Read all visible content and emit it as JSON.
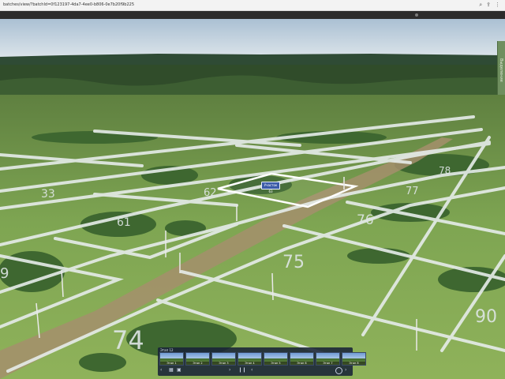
{
  "browser": {
    "url": "batches/view/?batchId=0f123197-4da7-4ee0-b806-0e7b20f9b225",
    "icons": [
      "magnifier-icon",
      "share-icon",
      "more-icon"
    ]
  },
  "side_panel": {
    "label": "Выделение"
  },
  "plots": [
    {
      "id": "plot-33",
      "label": "33"
    },
    {
      "id": "plot-61",
      "label": "61"
    },
    {
      "id": "plot-62",
      "label": "62"
    },
    {
      "id": "plot-75",
      "label": "75"
    },
    {
      "id": "plot-74",
      "label": "74"
    },
    {
      "id": "plot-76",
      "label": "76"
    },
    {
      "id": "plot-77",
      "label": "77"
    },
    {
      "id": "plot-78",
      "label": "78"
    },
    {
      "id": "plot-90",
      "label": "90"
    },
    {
      "id": "plot-9",
      "label": "9"
    }
  ],
  "selected_plot": {
    "tag": "Участок 63"
  },
  "viewer_bar": {
    "title": "Этап 12",
    "thumbs": [
      "Этап 1",
      "Этап 2",
      "Этап 3",
      "Этап 4",
      "Этап 5",
      "Этап 6",
      "Этап 7",
      "Этап 8"
    ],
    "controls": [
      "‹",
      "›",
      "‹",
      "›"
    ]
  },
  "colors": {
    "outline": "#e6ecea",
    "selected": "#ffffff",
    "tag_bg": "#3b5ba8",
    "bar_bg": "#19233a"
  }
}
